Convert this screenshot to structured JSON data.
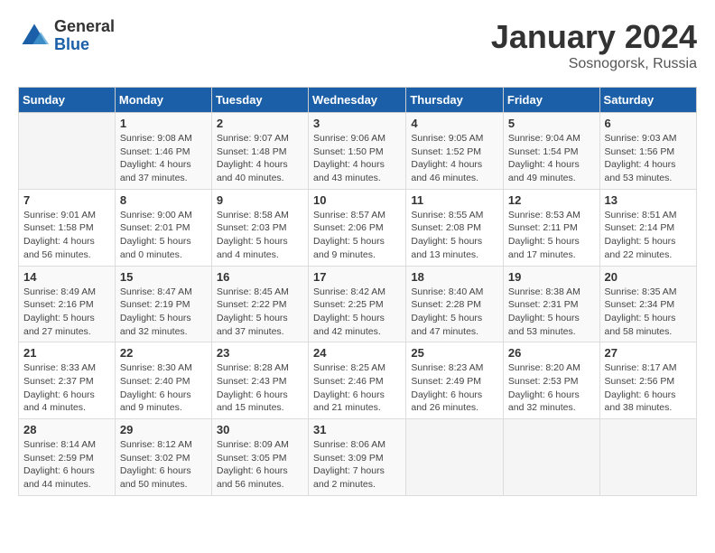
{
  "header": {
    "logo_general": "General",
    "logo_blue": "Blue",
    "month_title": "January 2024",
    "subtitle": "Sosnogorsk, Russia"
  },
  "days_of_week": [
    "Sunday",
    "Monday",
    "Tuesday",
    "Wednesday",
    "Thursday",
    "Friday",
    "Saturday"
  ],
  "weeks": [
    [
      {
        "day": "",
        "info": ""
      },
      {
        "day": "1",
        "info": "Sunrise: 9:08 AM\nSunset: 1:46 PM\nDaylight: 4 hours\nand 37 minutes."
      },
      {
        "day": "2",
        "info": "Sunrise: 9:07 AM\nSunset: 1:48 PM\nDaylight: 4 hours\nand 40 minutes."
      },
      {
        "day": "3",
        "info": "Sunrise: 9:06 AM\nSunset: 1:50 PM\nDaylight: 4 hours\nand 43 minutes."
      },
      {
        "day": "4",
        "info": "Sunrise: 9:05 AM\nSunset: 1:52 PM\nDaylight: 4 hours\nand 46 minutes."
      },
      {
        "day": "5",
        "info": "Sunrise: 9:04 AM\nSunset: 1:54 PM\nDaylight: 4 hours\nand 49 minutes."
      },
      {
        "day": "6",
        "info": "Sunrise: 9:03 AM\nSunset: 1:56 PM\nDaylight: 4 hours\nand 53 minutes."
      }
    ],
    [
      {
        "day": "7",
        "info": "Sunrise: 9:01 AM\nSunset: 1:58 PM\nDaylight: 4 hours\nand 56 minutes."
      },
      {
        "day": "8",
        "info": "Sunrise: 9:00 AM\nSunset: 2:01 PM\nDaylight: 5 hours\nand 0 minutes."
      },
      {
        "day": "9",
        "info": "Sunrise: 8:58 AM\nSunset: 2:03 PM\nDaylight: 5 hours\nand 4 minutes."
      },
      {
        "day": "10",
        "info": "Sunrise: 8:57 AM\nSunset: 2:06 PM\nDaylight: 5 hours\nand 9 minutes."
      },
      {
        "day": "11",
        "info": "Sunrise: 8:55 AM\nSunset: 2:08 PM\nDaylight: 5 hours\nand 13 minutes."
      },
      {
        "day": "12",
        "info": "Sunrise: 8:53 AM\nSunset: 2:11 PM\nDaylight: 5 hours\nand 17 minutes."
      },
      {
        "day": "13",
        "info": "Sunrise: 8:51 AM\nSunset: 2:14 PM\nDaylight: 5 hours\nand 22 minutes."
      }
    ],
    [
      {
        "day": "14",
        "info": "Sunrise: 8:49 AM\nSunset: 2:16 PM\nDaylight: 5 hours\nand 27 minutes."
      },
      {
        "day": "15",
        "info": "Sunrise: 8:47 AM\nSunset: 2:19 PM\nDaylight: 5 hours\nand 32 minutes."
      },
      {
        "day": "16",
        "info": "Sunrise: 8:45 AM\nSunset: 2:22 PM\nDaylight: 5 hours\nand 37 minutes."
      },
      {
        "day": "17",
        "info": "Sunrise: 8:42 AM\nSunset: 2:25 PM\nDaylight: 5 hours\nand 42 minutes."
      },
      {
        "day": "18",
        "info": "Sunrise: 8:40 AM\nSunset: 2:28 PM\nDaylight: 5 hours\nand 47 minutes."
      },
      {
        "day": "19",
        "info": "Sunrise: 8:38 AM\nSunset: 2:31 PM\nDaylight: 5 hours\nand 53 minutes."
      },
      {
        "day": "20",
        "info": "Sunrise: 8:35 AM\nSunset: 2:34 PM\nDaylight: 5 hours\nand 58 minutes."
      }
    ],
    [
      {
        "day": "21",
        "info": "Sunrise: 8:33 AM\nSunset: 2:37 PM\nDaylight: 6 hours\nand 4 minutes."
      },
      {
        "day": "22",
        "info": "Sunrise: 8:30 AM\nSunset: 2:40 PM\nDaylight: 6 hours\nand 9 minutes."
      },
      {
        "day": "23",
        "info": "Sunrise: 8:28 AM\nSunset: 2:43 PM\nDaylight: 6 hours\nand 15 minutes."
      },
      {
        "day": "24",
        "info": "Sunrise: 8:25 AM\nSunset: 2:46 PM\nDaylight: 6 hours\nand 21 minutes."
      },
      {
        "day": "25",
        "info": "Sunrise: 8:23 AM\nSunset: 2:49 PM\nDaylight: 6 hours\nand 26 minutes."
      },
      {
        "day": "26",
        "info": "Sunrise: 8:20 AM\nSunset: 2:53 PM\nDaylight: 6 hours\nand 32 minutes."
      },
      {
        "day": "27",
        "info": "Sunrise: 8:17 AM\nSunset: 2:56 PM\nDaylight: 6 hours\nand 38 minutes."
      }
    ],
    [
      {
        "day": "28",
        "info": "Sunrise: 8:14 AM\nSunset: 2:59 PM\nDaylight: 6 hours\nand 44 minutes."
      },
      {
        "day": "29",
        "info": "Sunrise: 8:12 AM\nSunset: 3:02 PM\nDaylight: 6 hours\nand 50 minutes."
      },
      {
        "day": "30",
        "info": "Sunrise: 8:09 AM\nSunset: 3:05 PM\nDaylight: 6 hours\nand 56 minutes."
      },
      {
        "day": "31",
        "info": "Sunrise: 8:06 AM\nSunset: 3:09 PM\nDaylight: 7 hours\nand 2 minutes."
      },
      {
        "day": "",
        "info": ""
      },
      {
        "day": "",
        "info": ""
      },
      {
        "day": "",
        "info": ""
      }
    ]
  ]
}
